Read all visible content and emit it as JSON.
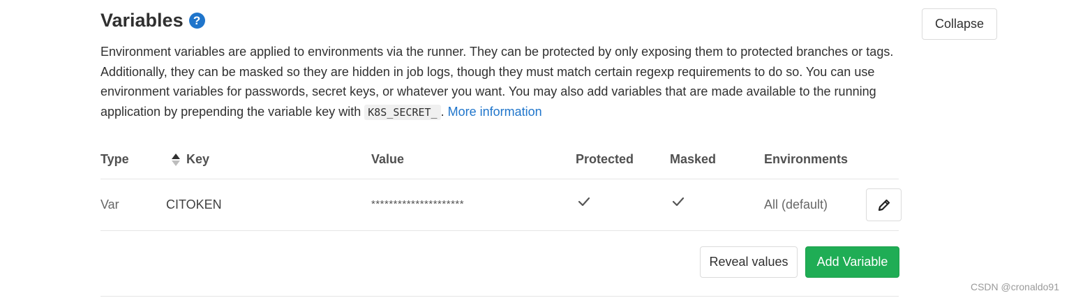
{
  "section": {
    "title": "Variables",
    "help_icon": "question-circle-icon",
    "collapse_label": "Collapse",
    "description": {
      "text_before_code": "Environment variables are applied to environments via the runner. They can be protected by only exposing them to protected branches or tags. Additionally, they can be masked so they are hidden in job logs, though they must match certain regexp requirements to do so. You can use environment variables for passwords, secret keys, or whatever you want. You may also add variables that are made available to the running application by prepending the variable key with ",
      "code": "K8S_SECRET_",
      "text_after_code": ". ",
      "link_text": "More information"
    }
  },
  "table": {
    "headers": {
      "type": "Type",
      "key": "Key",
      "value": "Value",
      "protected": "Protected",
      "masked": "Masked",
      "environments": "Environments"
    },
    "sort_icon": "sort-ascending-icon",
    "rows": [
      {
        "type": "Var",
        "key": "CITOKEN",
        "value": "*********************",
        "protected": true,
        "masked": true,
        "environments": "All (default)",
        "edit_icon": "pencil-icon"
      }
    ]
  },
  "actions": {
    "reveal_label": "Reveal values",
    "add_label": "Add Variable"
  },
  "colors": {
    "link": "#1f75cb",
    "primary_green": "#1fad55"
  },
  "watermark": "CSDN @cronaldo91"
}
